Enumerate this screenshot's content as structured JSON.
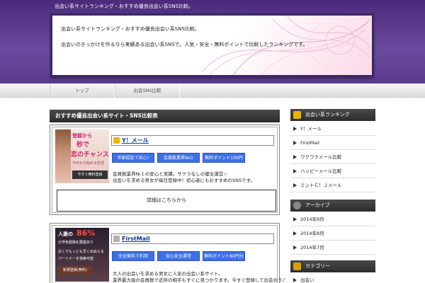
{
  "header": {
    "tagline": "出会い系サイトランキング・おすすめ優良出会い系SNS比較。",
    "hero_line1": "出会い系サイトランキング・おすすめ優良出会い系SNS比較。",
    "hero_line2": "出会いのきっかけを作るなら実績ある出会い系SNSで。人気・安全・無料ポイントで比較したランキングです。"
  },
  "nav": {
    "tabs": [
      "トップ",
      "出会SNS比較"
    ]
  },
  "main": {
    "title": "おすすめ優良出会い系サイト・SNS比較表",
    "entries": [
      {
        "name": "Y！メール",
        "tags": [
          "年齢認証で安心!",
          "会員数業界No1",
          "無料ポイント100円分"
        ],
        "desc1": "会員数業界№１の安心と実績。サクラなしの健全運営☆",
        "desc2": "出会いを求める男女が毎日登録中！初心者にもおすすめのSNSです。",
        "detail": "詳細はこちらから",
        "thumb": {
          "line1": "登録から",
          "line2": "秒で",
          "line3": "恋のチャンス",
          "line4": "今日から始める恋活",
          "btn": "今すぐ無料登録"
        }
      },
      {
        "name": "FirstMail",
        "tags": [
          "完全無料で利用",
          "安心安全運営",
          "無料ポイント80円分"
        ],
        "desc1": "大人の出会いを求める男女に人気の出会い系サイト。",
        "desc2": "業界最大級の会員数で近所の相手もすぐに見つかります。今すぐ登録して出会おう♪",
        "thumb": {
          "line1": "人妻の",
          "line2": "86%",
          "line3": "が浮気経験を願望あり",
          "line4": "近くでもっとも早く出会える",
          "line5": "パートナーを検索可能",
          "btn": "新規登録(無料)"
        }
      }
    ]
  },
  "sidebar": {
    "ranking_title": "出会い系ランキング",
    "ranking_items": [
      "Y！メール",
      "FirstMail",
      "ワクワクメール比較",
      "ハッピーメール比較",
      "ミントＣ！Ｊメール"
    ],
    "archive_title": "アーカイブ",
    "archive_items": [
      "2014年9月",
      "2014年8月",
      "2014年7月"
    ],
    "category_title": "カテゴリー",
    "category_items": [
      "出会い"
    ]
  }
}
